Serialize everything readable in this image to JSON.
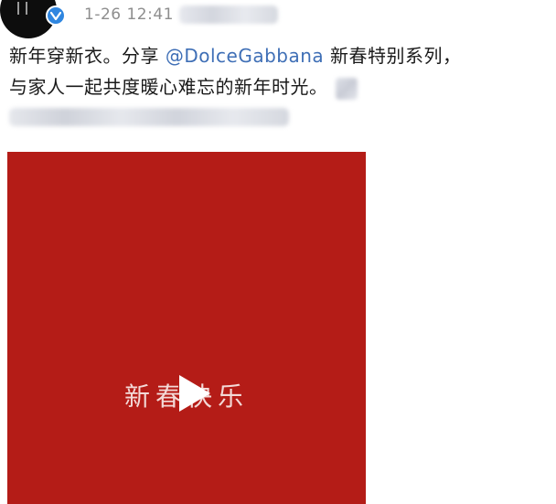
{
  "post": {
    "timestamp": "1-26 12:41",
    "text_line1_prefix": "新年穿新衣。分享 ",
    "mention": "@DolceGabbana",
    "text_line1_suffix": " 新春特别系列，",
    "text_line2": "与家人一起共度暖心难忘的新年时光。"
  },
  "video": {
    "caption": "新春快乐",
    "background_color": "#b41c17"
  },
  "icons": {
    "verified": "verified-badge-icon",
    "play": "play-icon"
  }
}
